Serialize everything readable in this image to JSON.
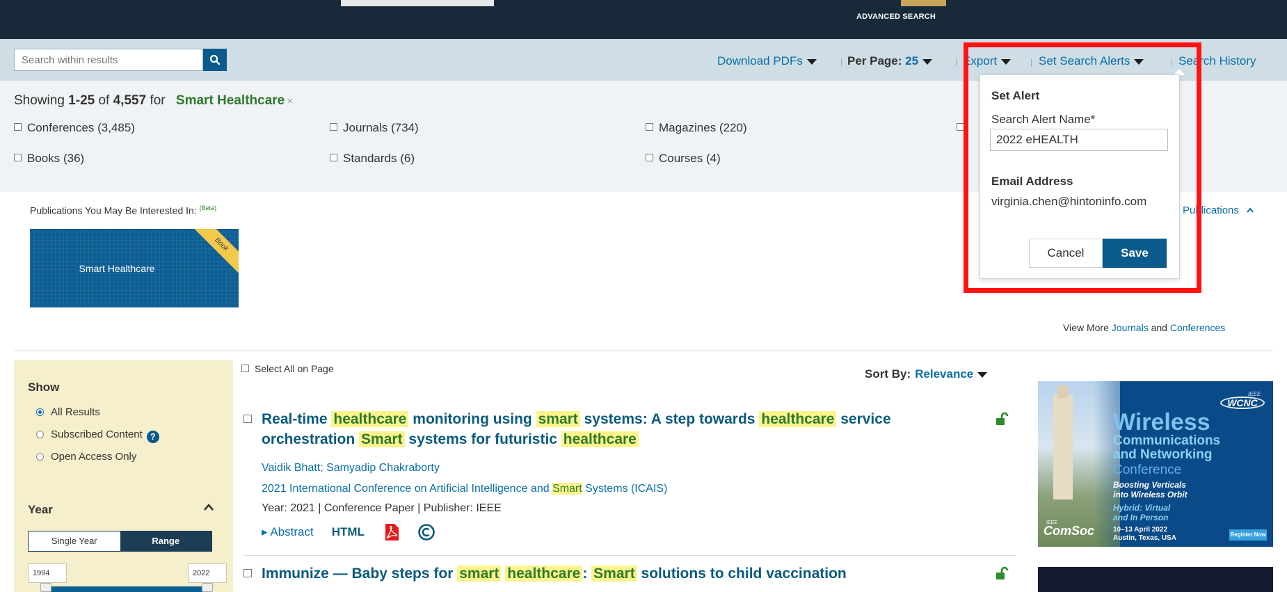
{
  "header": {
    "advanced_search": "ADVANCED SEARCH"
  },
  "toolbar": {
    "search_placeholder": "Search within results",
    "download_pdfs": "Download PDFs",
    "per_page_label": "Per Page:",
    "per_page_value": "25",
    "export": "Export",
    "set_search_alerts": "Set Search Alerts",
    "search_history": "Search History"
  },
  "results_info": {
    "showing_prefix": "Showing",
    "range": "1-25",
    "of_word": "of",
    "total": "4,557",
    "for_word": "for",
    "query": "Smart Healthcare",
    "clear": "×"
  },
  "facets": [
    {
      "label": "Conferences (3,485)"
    },
    {
      "label": "Journals (734)"
    },
    {
      "label": "Magazines (220)"
    },
    {
      "label": "Books (36)"
    },
    {
      "label": "Standards (6)"
    },
    {
      "label": "Courses (4)"
    }
  ],
  "publications": {
    "label": "Publications You May Be Interested In:",
    "beta": "(Beta)",
    "card_title": "Smart Healthcare",
    "card_badge": "Book",
    "toggle_link": "Publications",
    "view_more_prefix": "View More",
    "view_more_journals": "Journals",
    "view_more_and": "and",
    "view_more_conferences": "Conferences"
  },
  "filters": {
    "show_title": "Show",
    "options": [
      {
        "label": "All Results",
        "selected": true
      },
      {
        "label": "Subscribed Content",
        "selected": false
      },
      {
        "label": "Open Access Only",
        "selected": false
      }
    ],
    "year_title": "Year",
    "single_year": "Single Year",
    "range": "Range",
    "year_from": "1994",
    "year_to": "2022"
  },
  "results_list": {
    "select_all": "Select All on Page",
    "sort_label": "Sort By:",
    "sort_value": "Relevance"
  },
  "results": [
    {
      "title_parts": [
        "Real-time ",
        "healthcare",
        " monitoring using ",
        "smart",
        " systems: A step towards ",
        "healthcare",
        " service orchestration ",
        "Smart",
        " systems for futuristic ",
        "healthcare"
      ],
      "authors": "Vaidik Bhatt; Samyadip Chakraborty",
      "venue_parts": [
        "2021 International Conference on Artificial Intelligence and ",
        "Smart",
        " Systems (ICAIS)"
      ],
      "meta": "Year: 2021  |  Conference Paper  |  Publisher:  IEEE",
      "abstract": "Abstract",
      "html": "HTML"
    },
    {
      "title_parts": [
        "Immunize — Baby steps for ",
        "smart",
        " ",
        "healthcare",
        ": ",
        "Smart",
        " solutions to child vaccination"
      ]
    }
  ],
  "alert_popup": {
    "title": "Set Alert",
    "name_label": "Search Alert Name*",
    "name_value": "2022 eHEALTH",
    "email_label": "Email Address",
    "email_value": "virginia.chen@hintoninfo.com",
    "cancel": "Cancel",
    "save": "Save"
  },
  "ad": {
    "ieee": "IEEE",
    "wcnc": "WCNC",
    "line1": "Wireless",
    "line2": "Communications",
    "line3": "and Networking",
    "line4": "Conference",
    "tag1": "Boosting Verticals",
    "tag2": "into Wireless Orbit",
    "hybrid1": "Hybrid: Virtual",
    "hybrid2": "and In Person",
    "date1": "10–13 April 2022",
    "date2": "Austin, Texas, USA",
    "register": "Register Now",
    "comsoc_ieee": "IEEE",
    "comsoc": "ComSoc"
  },
  "colors": {
    "navy": "#182a3a",
    "link": "#0a6ea8",
    "highlight": "#fbf48c",
    "alert_frame": "#ff1212",
    "primary_button": "#0b5a8c"
  }
}
